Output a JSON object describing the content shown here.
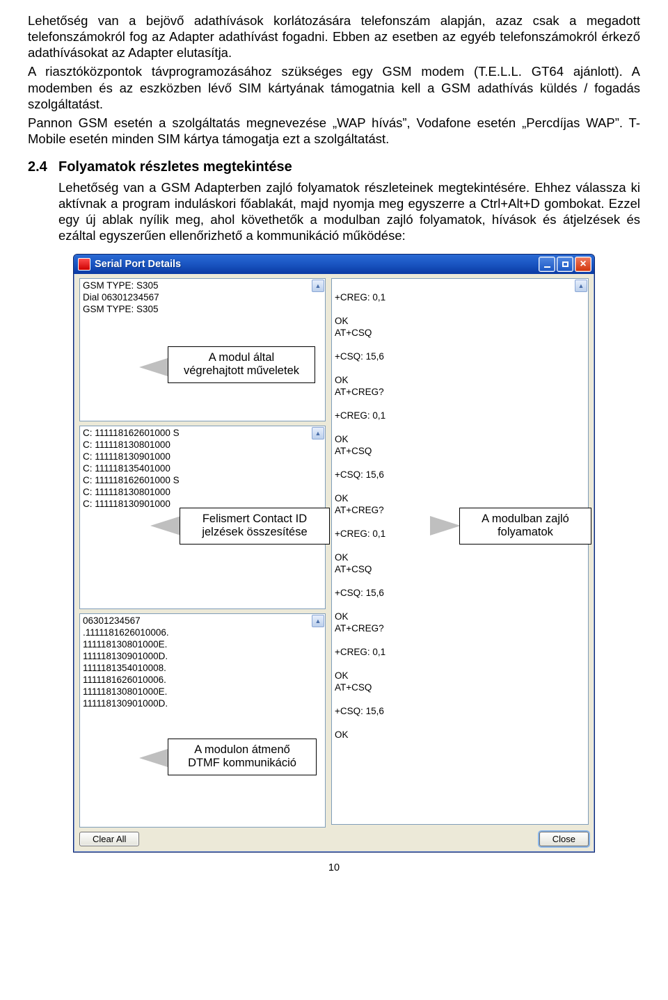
{
  "doc": {
    "p1": "Lehetőség van a bejövő adathívások korlátozására telefonszám alapján, azaz csak a megadott telefonszámokról fog az Adapter adathívást fogadni. Ebben az esetben az egyéb telefonszámokról érkező adathívásokat az Adapter elutasítja.",
    "p2": "A riasztóközpontok távprogramozásához szükséges egy GSM modem (T.E.L.L. GT64 ajánlott). A modemben és az eszközben lévő SIM kártyának támogatnia kell a GSM adathívás küldés / fogadás szolgáltatást.",
    "p3": "Pannon GSM esetén a szolgáltatás megnevezése „WAP hívás”, Vodafone esetén „Percdíjas WAP”. T-Mobile esetén minden SIM kártya támogatja ezt a szolgáltatást.",
    "heading_num": "2.4",
    "heading_text": "Folyamatok részletes megtekintése",
    "p4": "Lehetőség van a GSM Adapterben zajló folyamatok részleteinek megtekintésére. Ehhez válassza ki aktívnak a program induláskori főablakát, majd nyomja meg egyszerre a Ctrl+Alt+D gombokat. Ezzel egy új ablak nyílik meg, ahol követhetők a modulban zajló folyamatok, hívások és átjelzések és ezáltal egyszerűen ellenőrizhető a kommunikáció működése:",
    "page_number": "10"
  },
  "window": {
    "title": "Serial Port Details",
    "clear_all": "Clear All",
    "close": "Close"
  },
  "panes": {
    "left1": "GSM TYPE: S305\nDial 06301234567\nGSM TYPE: S305",
    "left2": "C: 111118162601000 S\nC: 111118130801000\nC: 111118130901000\nC: 111118135401000\nC: 111118162601000 S\nC: 111118130801000\nC: 111118130901000",
    "left3": "06301234567\n.1111181626010006.\n111118130801000E.\n111118130901000D.\n1111181354010008.\n1111181626010006.\n111118130801000E.\n111118130901000D.",
    "right": "\n+CREG: 0,1\n\nOK\nAT+CSQ\n\n+CSQ: 15,6\n\nOK\nAT+CREG?\n\n+CREG: 0,1\n\nOK\nAT+CSQ\n\n+CSQ: 15,6\n\nOK\nAT+CREG?\n\n+CREG: 0,1\n\nOK\nAT+CSQ\n\n+CSQ: 15,6\n\nOK\nAT+CREG?\n\n+CREG: 0,1\n\nOK\nAT+CSQ\n\n+CSQ: 15,6\n\nOK"
  },
  "callouts": {
    "c1": "A modul által\nvégrehajtott műveletek",
    "c2": "Felismert Contact ID\njelzések összesítése",
    "c3": "A modulon átmenő\nDTMF kommunikáció",
    "c4": "A modulban zajló\nfolyamatok"
  }
}
